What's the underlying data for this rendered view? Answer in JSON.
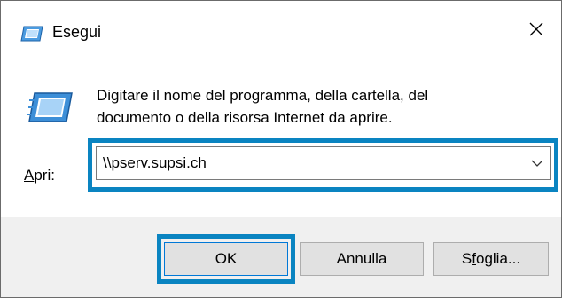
{
  "window": {
    "title": "Esegui",
    "close_glyph": "✕"
  },
  "content": {
    "description_line1": "Digitare il nome del programma, della cartella, del",
    "description_line2": "documento o della risorsa Internet da aprire.",
    "open_label_accel": "A",
    "open_label_rest": "pri:",
    "combo_value": "\\\\pserv.supsi.ch"
  },
  "buttons": {
    "ok": "OK",
    "cancel": "Annulla",
    "browse_prefix": "S",
    "browse_accel": "f",
    "browse_rest": "oglia..."
  },
  "icons": {
    "title": "run-icon",
    "main": "run-icon",
    "close": "close-icon",
    "dropdown": "chevron-down-icon"
  },
  "colors": {
    "highlight": "#0a84c1",
    "accent": "#0078d7",
    "icon_blue": "#1e78c8"
  }
}
